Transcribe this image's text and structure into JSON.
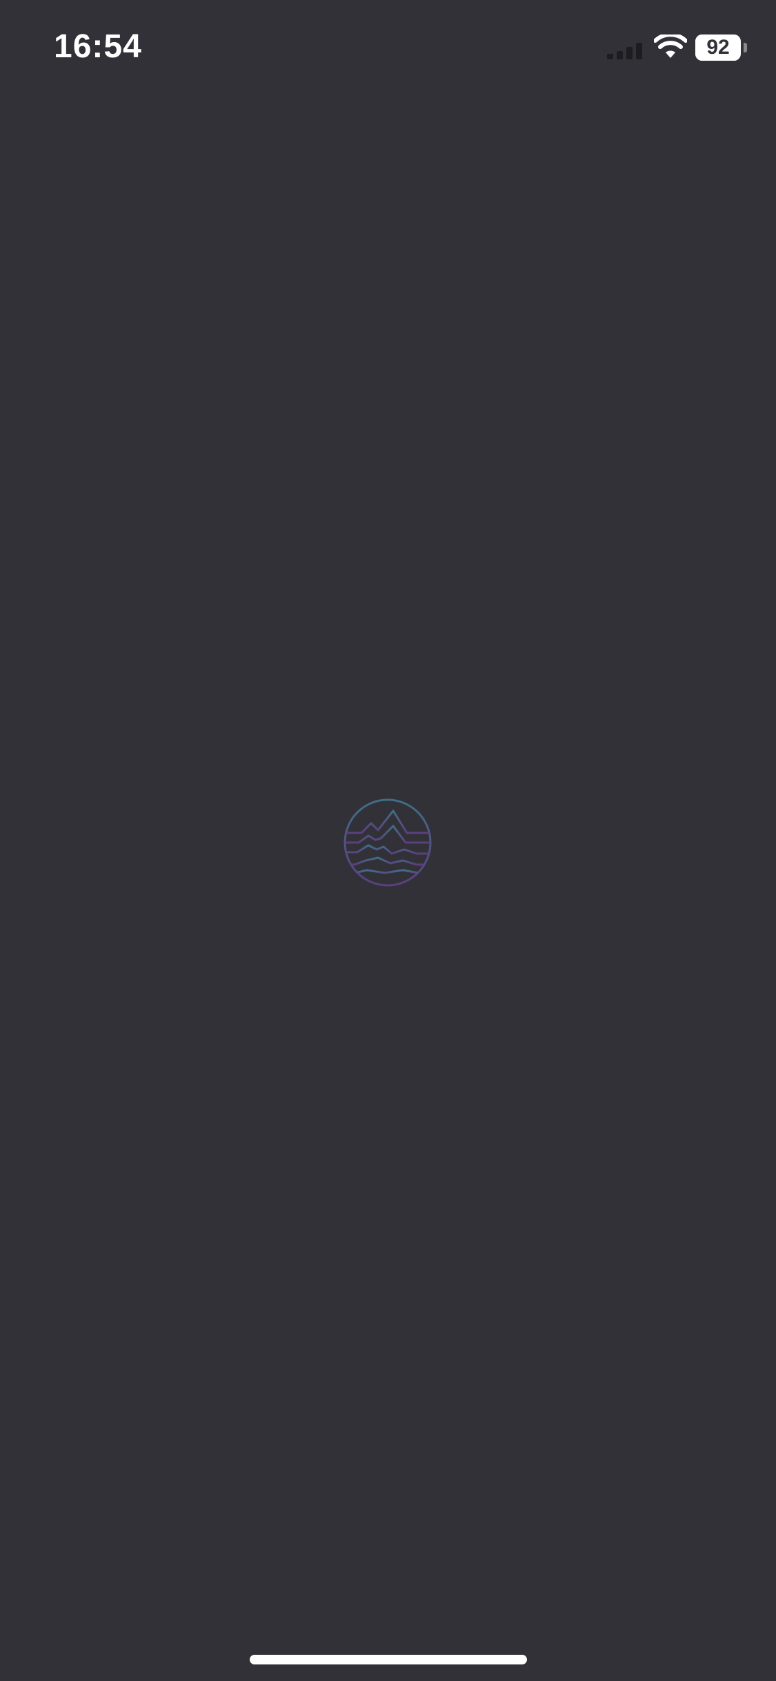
{
  "status_bar": {
    "time": "16:54",
    "battery_percent": "92",
    "battery_level": 0.92,
    "signal_icon": "cellular-signal-icon",
    "wifi_icon": "wifi-icon",
    "battery_icon": "battery-icon"
  },
  "splash": {
    "logo_icon": "mountain-waves-logo-icon",
    "logo_colors": [
      "#3f6f86",
      "#5b3f7e"
    ]
  },
  "colors": {
    "background": "#323138",
    "status_text": "#ffffff"
  }
}
